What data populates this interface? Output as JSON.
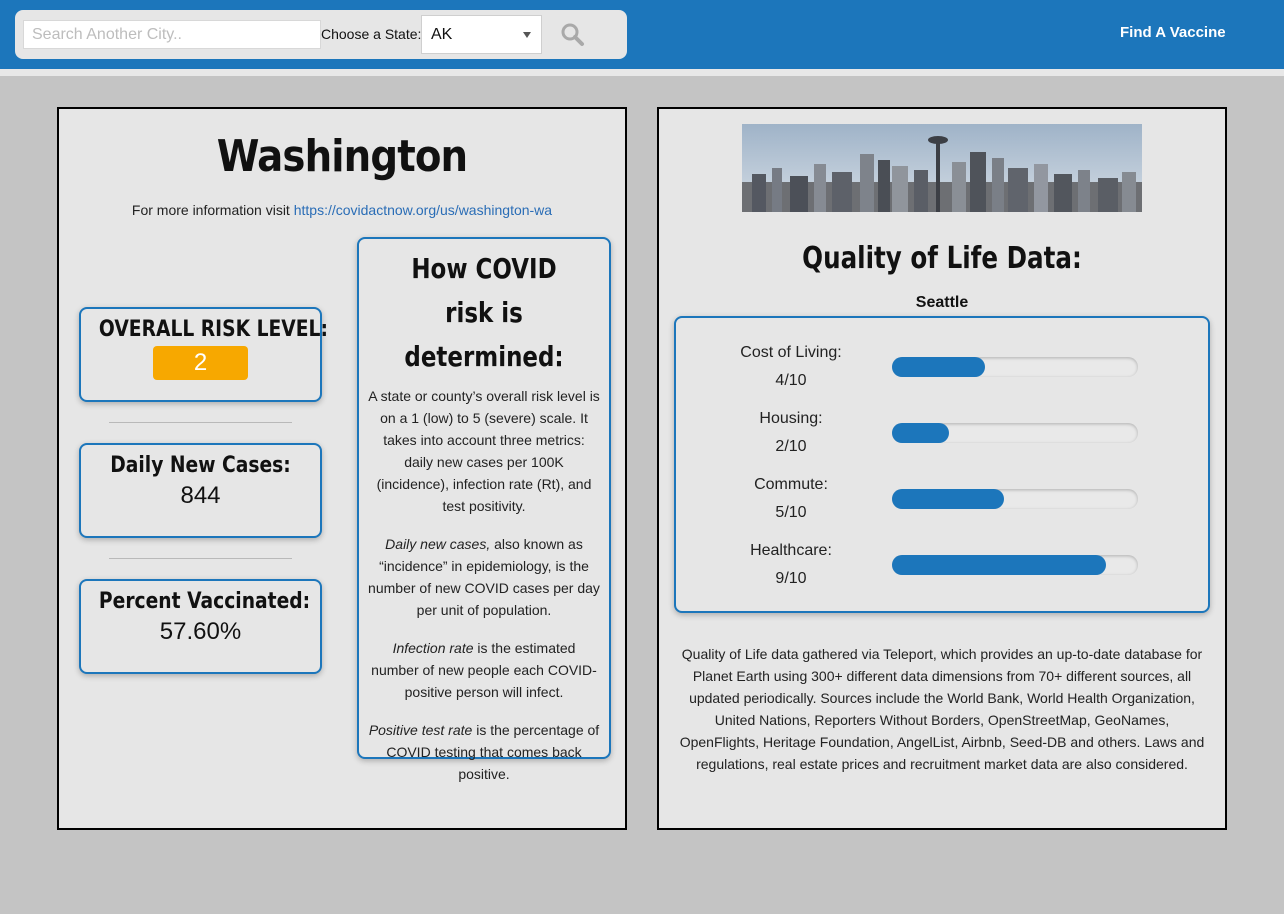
{
  "header": {
    "search_placeholder": "Search Another City..",
    "state_label": "Choose a State:",
    "state_selected": "AK",
    "find_vaccine_label": "Find A Vaccine"
  },
  "colors": {
    "brand": "#1c76bb",
    "risk_badge": "#f7a800"
  },
  "left_panel": {
    "city_title": "Washington",
    "more_info_text": "For more information visit ",
    "more_info_link": "https://covidactnow.org/us/washington-wa",
    "stats": {
      "risk_label": "OVERALL RISK LEVEL:",
      "risk_value": "2",
      "cases_label": "Daily New Cases:",
      "cases_value": "844",
      "vacc_label": "Percent Vaccinated:",
      "vacc_value": "57.60%"
    },
    "explain": {
      "title": "How COVID risk is determined:",
      "p1": "A state or county’s overall risk level is on a 1 (low) to 5 (severe) scale. It takes into account three metrics: daily new cases per 100K (incidence), infection rate (Rt), and test positivity.",
      "p2_em": "Daily new cases,",
      "p2_rest": " also known as “incidence” in epidemiology, is the number of new COVID cases per day per unit of population.",
      "p3_em": "Infection rate",
      "p3_rest": " is the estimated number of new people each COVID-positive person will infect.",
      "p4_em": "Positive test rate",
      "p4_rest": " is the percentage of COVID testing that comes back positive."
    }
  },
  "right_panel": {
    "qol_title": "Quality of Life Data:",
    "qol_city": "Seattle",
    "metrics": [
      {
        "name": "Cost of Living:",
        "score": "4/10",
        "fraction": 0.38
      },
      {
        "name": "Housing:",
        "score": "2/10",
        "fraction": 0.23
      },
      {
        "name": "Commute:",
        "score": "5/10",
        "fraction": 0.455
      },
      {
        "name": "Healthcare:",
        "score": "9/10",
        "fraction": 0.87
      }
    ],
    "note": "Quality of Life data gathered via Teleport, which provides an up-to-date database for Planet Earth using 300+ different data dimensions from 70+ different sources, all updated periodically. Sources include the World Bank, World Health Organization, United Nations, Reporters Without Borders, OpenStreetMap, GeoNames, OpenFlights, Heritage Foundation, AngelList, Airbnb, Seed-DB and others. Laws and regulations, real estate prices and recruitment market data are also considered."
  }
}
